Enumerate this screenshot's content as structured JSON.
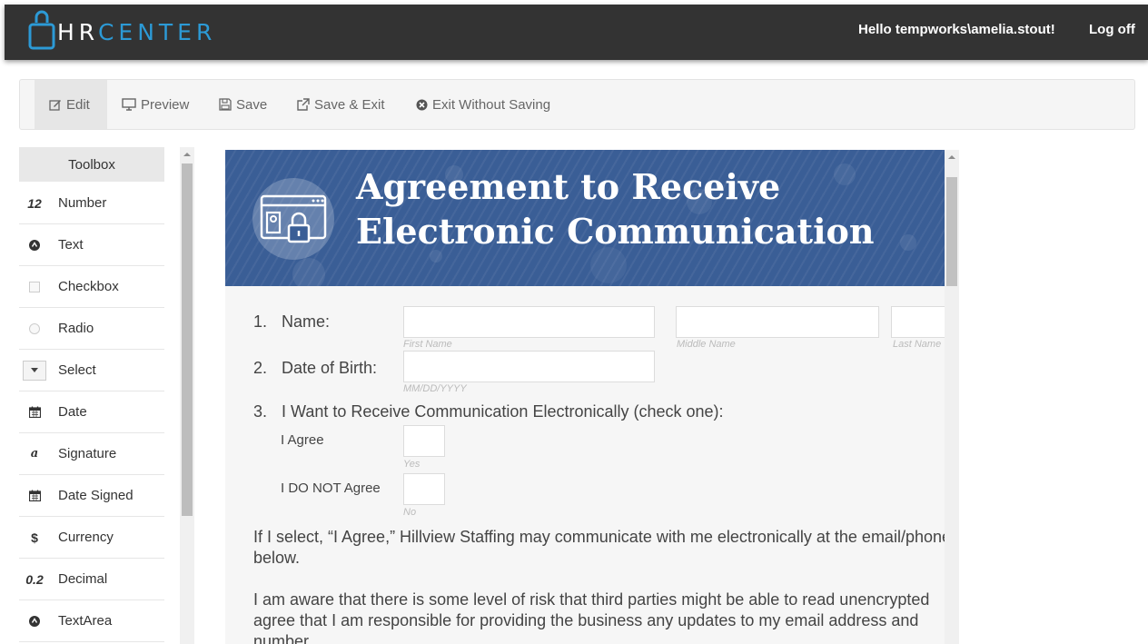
{
  "header": {
    "logo_hr": "HR",
    "logo_center": "CENTER",
    "greeting": "Hello tempworks\\amelia.stout!",
    "logoff": "Log off"
  },
  "toolbar": {
    "edit": "Edit",
    "preview": "Preview",
    "save": "Save",
    "save_exit": "Save & Exit",
    "exit_without_saving": "Exit Without Saving"
  },
  "toolbox": {
    "title": "Toolbox",
    "items": [
      {
        "icon": "12",
        "label": "Number"
      },
      {
        "icon": "circle-icon",
        "label": "Text"
      },
      {
        "icon": "checkbox-icon",
        "label": "Checkbox"
      },
      {
        "icon": "radio-icon",
        "label": "Radio"
      },
      {
        "icon": "select-icon",
        "label": "Select"
      },
      {
        "icon": "calendar-icon",
        "label": "Date"
      },
      {
        "icon": "a",
        "label": "Signature"
      },
      {
        "icon": "calendar-icon",
        "label": "Date Signed"
      },
      {
        "icon": "$",
        "label": "Currency"
      },
      {
        "icon": "0.2",
        "label": "Decimal"
      },
      {
        "icon": "circle-icon",
        "label": "TextArea"
      }
    ]
  },
  "document": {
    "banner_title_line1": "Agreement to Receive",
    "banner_title_line2": "Electronic Communication",
    "q1": {
      "num": "1.",
      "label": "Name:",
      "hint_first": "First Name",
      "hint_middle": "Middle Name",
      "hint_last": "Last Name"
    },
    "q2": {
      "num": "2.",
      "label": "Date of Birth:",
      "hint": "MM/DD/YYYY"
    },
    "q3": {
      "num": "3.",
      "label": "I Want to Receive Communication Electronically (check one):",
      "agree": "I Agree",
      "agree_hint": "Yes",
      "disagree": "I DO NOT Agree",
      "disagree_hint": "No"
    },
    "para1_line1": "If I select, “I Agree,” Hillview Staffing may communicate with me electronically at the email/phone",
    "para1_line2": "below.",
    "para2_line1": "I am aware that there is some level of risk that third parties might be able to read unencrypted",
    "para2_line2": "agree that I am responsible for providing the business any updates to my email address and",
    "para2_line3": "number."
  },
  "colors": {
    "topbar": "#333333",
    "accent": "#2c9ad6",
    "banner": "#3a5e96"
  }
}
